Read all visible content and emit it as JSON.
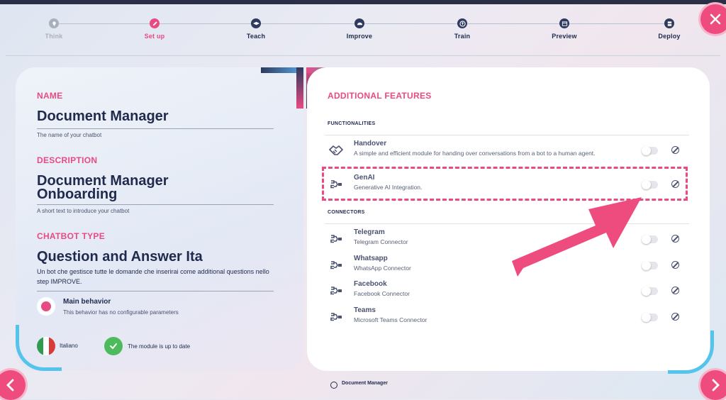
{
  "stepper": {
    "steps": [
      {
        "label": "Think",
        "state": "done"
      },
      {
        "label": "Set up",
        "state": "active"
      },
      {
        "label": "Teach",
        "state": "todo"
      },
      {
        "label": "Improve",
        "state": "todo"
      },
      {
        "label": "Train",
        "state": "todo"
      },
      {
        "label": "Preview",
        "state": "todo"
      },
      {
        "label": "Deploy",
        "state": "todo"
      }
    ]
  },
  "left": {
    "name_title": "NAME",
    "name_value": "Document Manager",
    "name_hint": "The name of your chatbot",
    "description_title": "DESCRIPTION",
    "description_line1": "Document Manager",
    "description_line2": "Onboarding",
    "description_hint": "A short text to introduce your chatbot",
    "type_title": "CHATBOT TYPE",
    "type_value": "Question and Answer Ita",
    "type_desc": "Un bot che gestisce tutte le domande che inserirai come additional questions nello step IMPROVE.",
    "behavior_title": "Main behavior",
    "behavior_sub": "This behavior has no configurable parameters",
    "language": "Italiano",
    "module_status": "The module is up to date"
  },
  "right": {
    "title": "ADDITIONAL FEATURES",
    "functionalities_label": "FUNCTIONALITIES",
    "connectors_label": "CONNECTORS",
    "functionalities": [
      {
        "name": "Handover",
        "desc": "A simple and efficient module for handing over conversations from a bot to a human agent.",
        "icon": "handshake-icon",
        "enabled": false
      },
      {
        "name": "GenAI",
        "desc": "Generative AI Integration.",
        "icon": "plug-icon",
        "enabled": false
      }
    ],
    "connectors": [
      {
        "name": "Telegram",
        "desc": "Telegram Connector",
        "icon": "plug-icon",
        "enabled": false
      },
      {
        "name": "Whatsapp",
        "desc": "WhatsApp Connector",
        "icon": "plug-icon",
        "enabled": false
      },
      {
        "name": "Facebook",
        "desc": "Facebook Connector",
        "icon": "plug-icon",
        "enabled": false
      },
      {
        "name": "Teams",
        "desc": "Microsoft Teams Connector",
        "icon": "plug-icon",
        "enabled": false
      }
    ]
  },
  "footer": {
    "label": "Document Manager"
  },
  "colors": {
    "accent": "#e84a82",
    "navy": "#1f2a4d",
    "cyan": "#55c4ec",
    "success": "#4dbb5b"
  }
}
